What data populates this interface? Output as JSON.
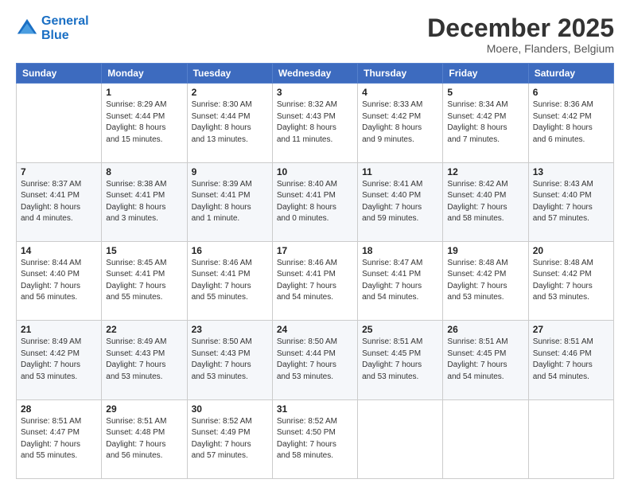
{
  "logo": {
    "line1": "General",
    "line2": "Blue"
  },
  "title": "December 2025",
  "subtitle": "Moere, Flanders, Belgium",
  "weekdays": [
    "Sunday",
    "Monday",
    "Tuesday",
    "Wednesday",
    "Thursday",
    "Friday",
    "Saturday"
  ],
  "weeks": [
    [
      {
        "day": "",
        "detail": ""
      },
      {
        "day": "1",
        "detail": "Sunrise: 8:29 AM\nSunset: 4:44 PM\nDaylight: 8 hours\nand 15 minutes."
      },
      {
        "day": "2",
        "detail": "Sunrise: 8:30 AM\nSunset: 4:44 PM\nDaylight: 8 hours\nand 13 minutes."
      },
      {
        "day": "3",
        "detail": "Sunrise: 8:32 AM\nSunset: 4:43 PM\nDaylight: 8 hours\nand 11 minutes."
      },
      {
        "day": "4",
        "detail": "Sunrise: 8:33 AM\nSunset: 4:42 PM\nDaylight: 8 hours\nand 9 minutes."
      },
      {
        "day": "5",
        "detail": "Sunrise: 8:34 AM\nSunset: 4:42 PM\nDaylight: 8 hours\nand 7 minutes."
      },
      {
        "day": "6",
        "detail": "Sunrise: 8:36 AM\nSunset: 4:42 PM\nDaylight: 8 hours\nand 6 minutes."
      }
    ],
    [
      {
        "day": "7",
        "detail": "Sunrise: 8:37 AM\nSunset: 4:41 PM\nDaylight: 8 hours\nand 4 minutes."
      },
      {
        "day": "8",
        "detail": "Sunrise: 8:38 AM\nSunset: 4:41 PM\nDaylight: 8 hours\nand 3 minutes."
      },
      {
        "day": "9",
        "detail": "Sunrise: 8:39 AM\nSunset: 4:41 PM\nDaylight: 8 hours\nand 1 minute."
      },
      {
        "day": "10",
        "detail": "Sunrise: 8:40 AM\nSunset: 4:41 PM\nDaylight: 8 hours\nand 0 minutes."
      },
      {
        "day": "11",
        "detail": "Sunrise: 8:41 AM\nSunset: 4:40 PM\nDaylight: 7 hours\nand 59 minutes."
      },
      {
        "day": "12",
        "detail": "Sunrise: 8:42 AM\nSunset: 4:40 PM\nDaylight: 7 hours\nand 58 minutes."
      },
      {
        "day": "13",
        "detail": "Sunrise: 8:43 AM\nSunset: 4:40 PM\nDaylight: 7 hours\nand 57 minutes."
      }
    ],
    [
      {
        "day": "14",
        "detail": "Sunrise: 8:44 AM\nSunset: 4:40 PM\nDaylight: 7 hours\nand 56 minutes."
      },
      {
        "day": "15",
        "detail": "Sunrise: 8:45 AM\nSunset: 4:41 PM\nDaylight: 7 hours\nand 55 minutes."
      },
      {
        "day": "16",
        "detail": "Sunrise: 8:46 AM\nSunset: 4:41 PM\nDaylight: 7 hours\nand 55 minutes."
      },
      {
        "day": "17",
        "detail": "Sunrise: 8:46 AM\nSunset: 4:41 PM\nDaylight: 7 hours\nand 54 minutes."
      },
      {
        "day": "18",
        "detail": "Sunrise: 8:47 AM\nSunset: 4:41 PM\nDaylight: 7 hours\nand 54 minutes."
      },
      {
        "day": "19",
        "detail": "Sunrise: 8:48 AM\nSunset: 4:42 PM\nDaylight: 7 hours\nand 53 minutes."
      },
      {
        "day": "20",
        "detail": "Sunrise: 8:48 AM\nSunset: 4:42 PM\nDaylight: 7 hours\nand 53 minutes."
      }
    ],
    [
      {
        "day": "21",
        "detail": "Sunrise: 8:49 AM\nSunset: 4:42 PM\nDaylight: 7 hours\nand 53 minutes."
      },
      {
        "day": "22",
        "detail": "Sunrise: 8:49 AM\nSunset: 4:43 PM\nDaylight: 7 hours\nand 53 minutes."
      },
      {
        "day": "23",
        "detail": "Sunrise: 8:50 AM\nSunset: 4:43 PM\nDaylight: 7 hours\nand 53 minutes."
      },
      {
        "day": "24",
        "detail": "Sunrise: 8:50 AM\nSunset: 4:44 PM\nDaylight: 7 hours\nand 53 minutes."
      },
      {
        "day": "25",
        "detail": "Sunrise: 8:51 AM\nSunset: 4:45 PM\nDaylight: 7 hours\nand 53 minutes."
      },
      {
        "day": "26",
        "detail": "Sunrise: 8:51 AM\nSunset: 4:45 PM\nDaylight: 7 hours\nand 54 minutes."
      },
      {
        "day": "27",
        "detail": "Sunrise: 8:51 AM\nSunset: 4:46 PM\nDaylight: 7 hours\nand 54 minutes."
      }
    ],
    [
      {
        "day": "28",
        "detail": "Sunrise: 8:51 AM\nSunset: 4:47 PM\nDaylight: 7 hours\nand 55 minutes."
      },
      {
        "day": "29",
        "detail": "Sunrise: 8:51 AM\nSunset: 4:48 PM\nDaylight: 7 hours\nand 56 minutes."
      },
      {
        "day": "30",
        "detail": "Sunrise: 8:52 AM\nSunset: 4:49 PM\nDaylight: 7 hours\nand 57 minutes."
      },
      {
        "day": "31",
        "detail": "Sunrise: 8:52 AM\nSunset: 4:50 PM\nDaylight: 7 hours\nand 58 minutes."
      },
      {
        "day": "",
        "detail": ""
      },
      {
        "day": "",
        "detail": ""
      },
      {
        "day": "",
        "detail": ""
      }
    ]
  ]
}
